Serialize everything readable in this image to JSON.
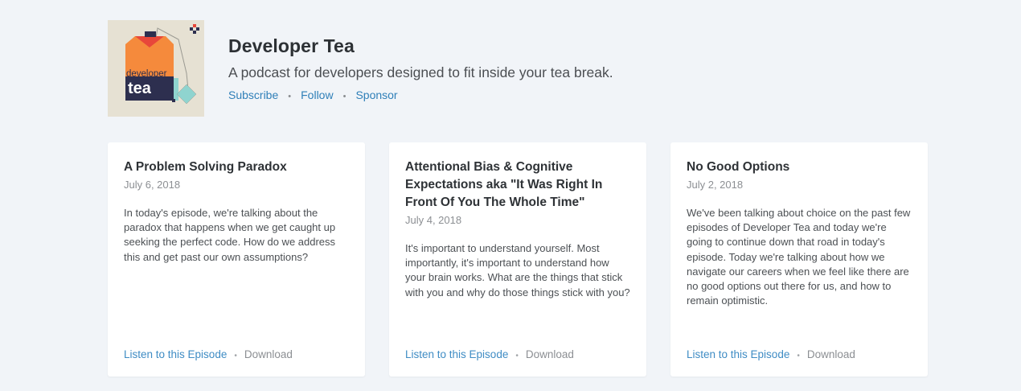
{
  "podcast": {
    "title": "Developer Tea",
    "description": "A podcast for developers designed to fit inside your tea break.",
    "cover_text_top": "developer",
    "cover_text_bottom": "tea",
    "links": {
      "subscribe": "Subscribe",
      "follow": "Follow",
      "sponsor": "Sponsor",
      "separator": "•"
    }
  },
  "episodes": [
    {
      "title": "A Problem Solving Paradox",
      "date": "July 6, 2018",
      "description": "In today's episode, we're talking about the paradox that happens when we get caught up seeking the perfect code. How do we address this and get past our own assumptions?",
      "listen_label": "Listen to this Episode",
      "download_label": "Download",
      "separator": "•"
    },
    {
      "title": "Attentional Bias & Cognitive Expectations aka \"It Was Right In Front Of You The Whole Time\"",
      "date": "July 4, 2018",
      "description": "It's important to understand yourself. Most importantly, it's important to understand how your brain works. What are the things that stick with you and why do those things stick with you?",
      "listen_label": "Listen to this Episode",
      "download_label": "Download",
      "separator": "•"
    },
    {
      "title": "No Good Options",
      "date": "July 2, 2018",
      "description": "We've been talking about choice on the past few episodes of Developer Tea and today we're going to continue down that road in today's episode. Today we're talking about how we navigate our careers when we feel like there are no good options out there for us, and how to remain optimistic.",
      "listen_label": "Listen to this Episode",
      "download_label": "Download",
      "separator": "•"
    }
  ],
  "colors": {
    "background": "#f1f4f8",
    "link": "#3f8cc4",
    "cover_orange": "#f58a3c",
    "cover_navy": "#2d2f4f",
    "cover_teal": "#8fd4cf",
    "cover_bg": "#e6e1d3"
  }
}
